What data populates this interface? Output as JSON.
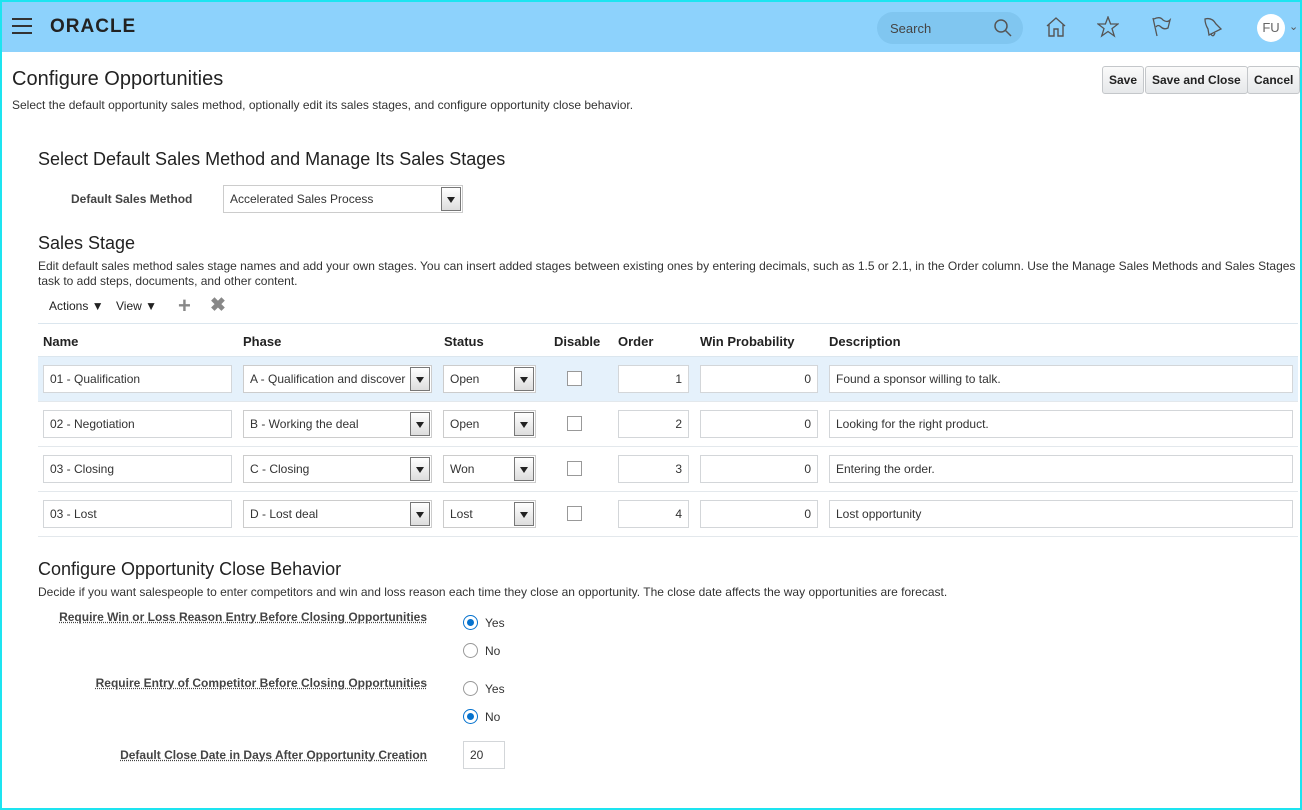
{
  "header": {
    "logo": "ORACLE",
    "search_placeholder": "Search",
    "avatar": "FU"
  },
  "page": {
    "title": "Configure Opportunities",
    "subtitle": "Select the default opportunity sales method, optionally edit its sales stages, and configure opportunity close behavior.",
    "save": "Save",
    "save_close": "Save and Close",
    "cancel": "Cancel"
  },
  "method": {
    "heading": "Select Default Sales Method and Manage Its Sales Stages",
    "label": "Default Sales Method",
    "value": "Accelerated Sales Process"
  },
  "stages": {
    "heading": "Sales Stage",
    "description": "Edit default sales method sales stage names and add your own stages. You can insert added stages between existing ones by entering decimals, such as 1.5 or 2.1, in the Order column. Use the Manage Sales Methods and Sales Stages task to add steps, documents, and other content.",
    "actions": "Actions",
    "view": "View",
    "columns": [
      "Name",
      "Phase",
      "Status",
      "Disable",
      "Order",
      "Win Probability",
      "Description"
    ],
    "rows": [
      {
        "name": "01 - Qualification",
        "phase": "A - Qualification and discover",
        "status": "Open",
        "disabled": false,
        "order": "1",
        "win": "0",
        "desc": "Found a sponsor willing to talk."
      },
      {
        "name": "02 - Negotiation",
        "phase": "B - Working the deal",
        "status": "Open",
        "disabled": false,
        "order": "2",
        "win": "0",
        "desc": "Looking for the right product."
      },
      {
        "name": "03 - Closing",
        "phase": "C - Closing",
        "status": "Won",
        "disabled": false,
        "order": "3",
        "win": "0",
        "desc": "Entering the order."
      },
      {
        "name": "03 - Lost",
        "phase": "D - Lost deal",
        "status": "Lost",
        "disabled": false,
        "order": "4",
        "win": "0",
        "desc": "Lost opportunity"
      }
    ]
  },
  "close": {
    "heading": "Configure Opportunity Close Behavior",
    "description": "Decide if you want salespeople to enter competitors and win and loss reason each time they close an opportunity. The close date affects the way opportunities are forecast.",
    "q1": "Require Win or Loss Reason Entry Before Closing Opportunities",
    "q1_value": "Yes",
    "q2": "Require Entry of Competitor Before Closing Opportunities",
    "q2_value": "No",
    "yes": "Yes",
    "no": "No",
    "q3": "Default Close Date in Days After Opportunity Creation",
    "q3_value": "20"
  }
}
